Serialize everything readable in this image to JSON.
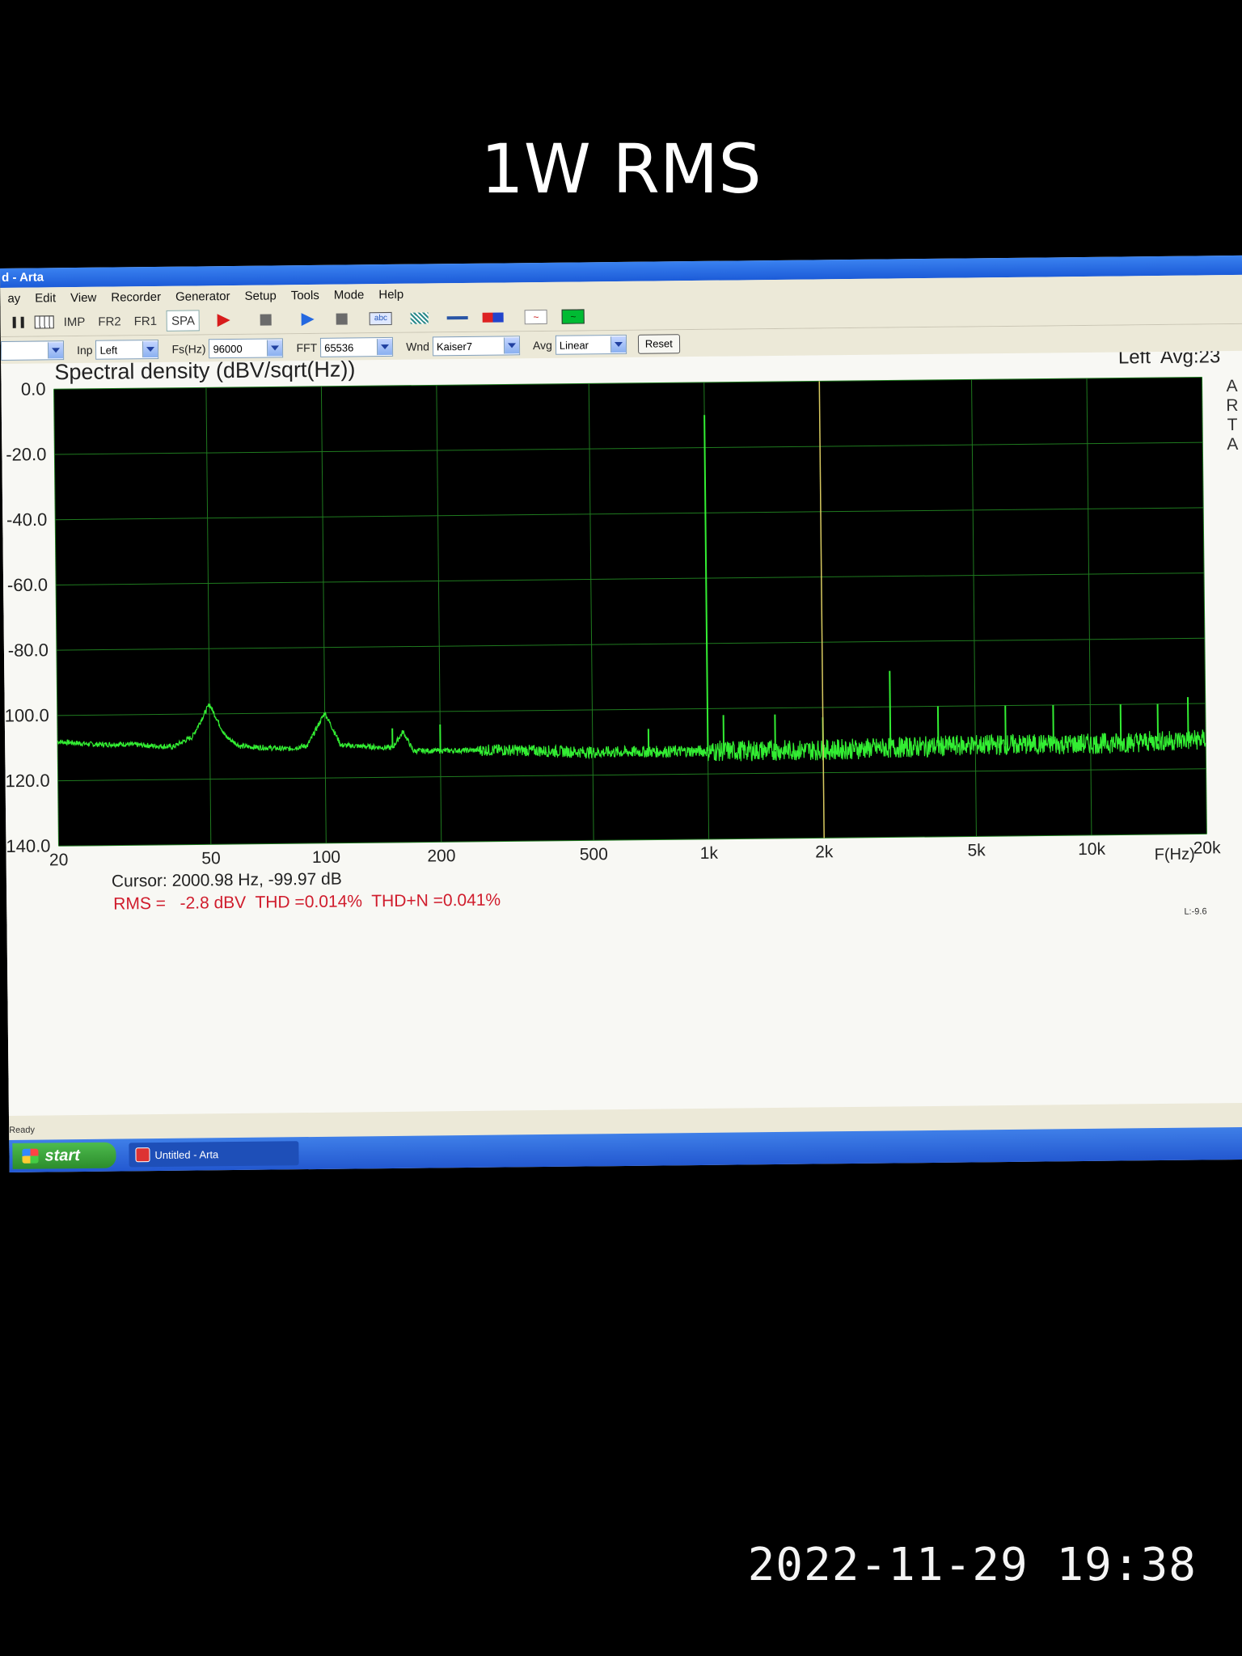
{
  "caption": "1W RMS",
  "timestamp": "2022-11-29 19:38",
  "window": {
    "title": "d - Arta",
    "menu": [
      "ay",
      "Edit",
      "View",
      "Recorder",
      "Generator",
      "Setup",
      "Tools",
      "Mode",
      "Help"
    ]
  },
  "toolbar": {
    "imp": "IMP",
    "fr2": "FR2",
    "fr1": "FR1",
    "spa": "SPA",
    "abc_icon": "abc"
  },
  "params": {
    "inp_label": "Inp",
    "inp_value": "Left",
    "fs_label": "Fs(Hz)",
    "fs_value": "96000",
    "fft_label": "FFT",
    "fft_value": "65536",
    "wnd_label": "Wnd",
    "wnd_value": "Kaiser7",
    "avg_label": "Avg",
    "avg_value": "Linear",
    "reset": "Reset"
  },
  "plot": {
    "channel_avg": "Left  Avg:23",
    "side_logo": "ARTA",
    "cursor_text": "Cursor: 2000.98 Hz, -99.97 dB",
    "rms_text": "RMS =   -2.8 dBV  THD =0.014%  THD+N =0.041%",
    "status_right": "L:-9.6"
  },
  "status": {
    "left": "Ready"
  },
  "taskbar": {
    "start": "start",
    "item": "Untitled - Arta"
  },
  "colors": {
    "trace": "#33ee33",
    "cursor": "#d8c860",
    "grid": "#1f7a1f",
    "readout": "#d01c2c"
  },
  "chart_data": {
    "type": "line",
    "title": "Spectral density (dBV/sqrt(Hz))",
    "xlabel": "F(Hz)",
    "ylabel": "",
    "xscale": "log",
    "xlim": [
      20,
      20000
    ],
    "ylim": [
      -140,
      0
    ],
    "xticks": [
      20,
      50,
      100,
      200,
      500,
      1000,
      2000,
      5000,
      10000,
      20000
    ],
    "xtick_labels": [
      "20",
      "50",
      "100",
      "200",
      "500",
      "1k",
      "2k",
      "5k",
      "10k",
      "20k"
    ],
    "yticks": [
      0,
      -20,
      -40,
      -60,
      -80,
      -100,
      -120,
      -140
    ],
    "ytick_labels": [
      "0.0",
      "-20.0",
      "-40.0",
      "-60.0",
      "-80.0",
      "-100.0",
      "-120.0",
      "-140.0"
    ],
    "grid": true,
    "cursor_x": 2000.98,
    "noise_floor": [
      [
        20,
        -108
      ],
      [
        25,
        -109
      ],
      [
        30,
        -109
      ],
      [
        40,
        -110
      ],
      [
        45,
        -107
      ],
      [
        50,
        -97
      ],
      [
        55,
        -107
      ],
      [
        60,
        -110
      ],
      [
        80,
        -111
      ],
      [
        90,
        -110
      ],
      [
        100,
        -100
      ],
      [
        110,
        -110
      ],
      [
        150,
        -111
      ],
      [
        160,
        -106
      ],
      [
        170,
        -112
      ],
      [
        200,
        -112
      ],
      [
        300,
        -112
      ],
      [
        500,
        -113
      ],
      [
        1000,
        -113
      ],
      [
        2000,
        -113
      ],
      [
        5000,
        -112
      ],
      [
        10000,
        -112
      ],
      [
        20000,
        -111
      ]
    ],
    "peaks": [
      [
        50,
        -97
      ],
      [
        100,
        -100
      ],
      [
        150,
        -105
      ],
      [
        200,
        -104
      ],
      [
        700,
        -106
      ],
      [
        1000,
        -10
      ],
      [
        1100,
        -102
      ],
      [
        1500,
        -102
      ],
      [
        2000,
        -103
      ],
      [
        3000,
        -89
      ],
      [
        4000,
        -100
      ],
      [
        6000,
        -100
      ],
      [
        8000,
        -100
      ],
      [
        12000,
        -100
      ],
      [
        15000,
        -100
      ],
      [
        18000,
        -98
      ]
    ]
  }
}
